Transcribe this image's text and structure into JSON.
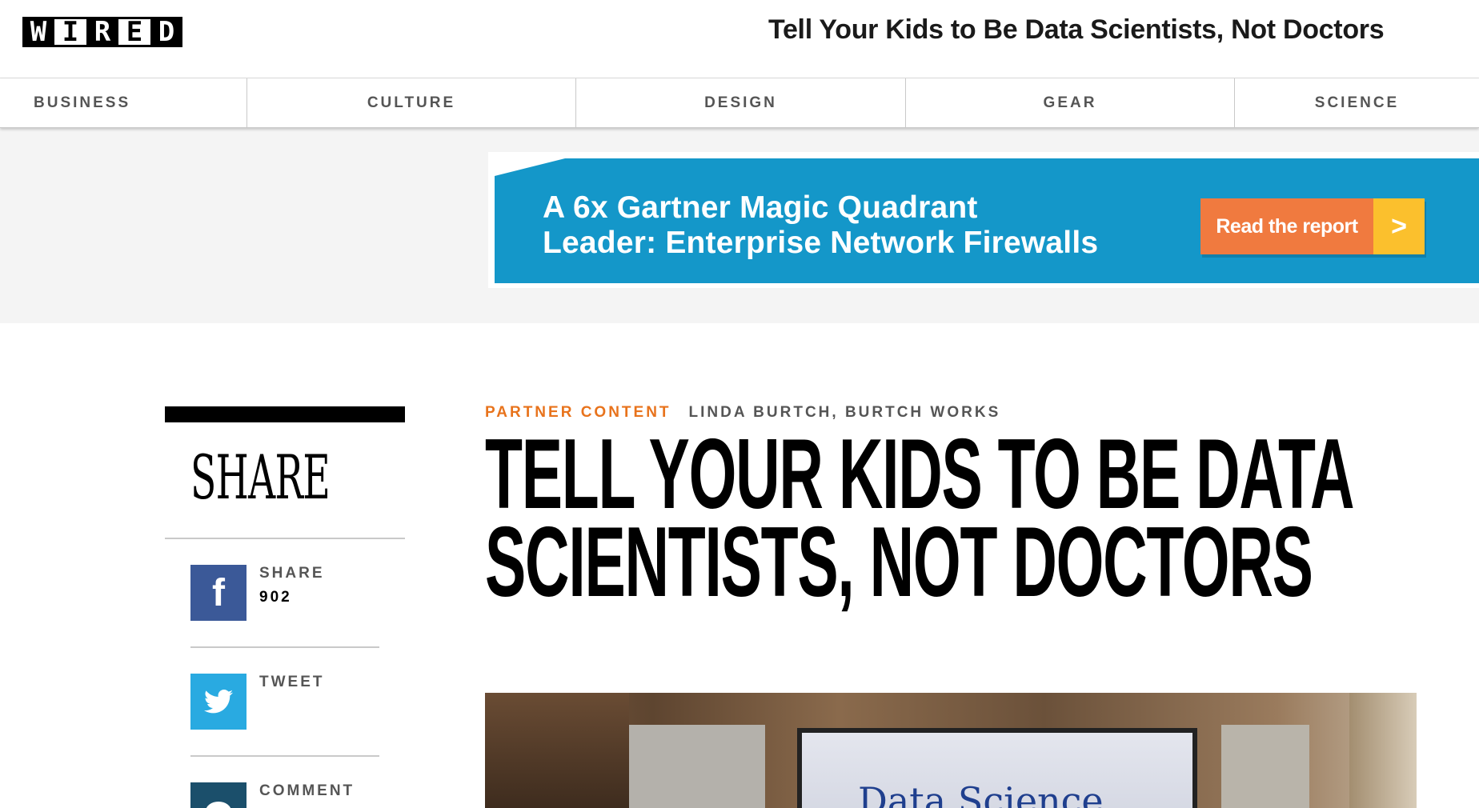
{
  "header": {
    "logo_letters": [
      "W",
      "I",
      "R",
      "E",
      "D"
    ],
    "title": "Tell Your Kids to Be Data Scientists, Not Doctors"
  },
  "nav": {
    "items": [
      "BUSINESS",
      "CULTURE",
      "DESIGN",
      "GEAR",
      "SCIENCE"
    ]
  },
  "ad": {
    "line1": "A 6x Gartner Magic Quadrant",
    "line2": "Leader: Enterprise Network Firewalls",
    "button_label": "Read the report",
    "button_arrow": ">",
    "colors": {
      "background": "#1497c9",
      "button": "#f07a3f",
      "arrow": "#fbc02d"
    }
  },
  "share": {
    "heading": "SHARE",
    "facebook": {
      "label": "SHARE",
      "count": "902",
      "icon": "facebook-icon"
    },
    "twitter": {
      "label": "TWEET",
      "icon": "twitter-icon"
    },
    "comment": {
      "label": "COMMENT",
      "icon": "comment-icon"
    }
  },
  "article": {
    "kicker": "PARTNER CONTENT",
    "byline": "LINDA BURTCH, BURTCH WORKS",
    "headline_line1": "TELL YOUR KIDS TO BE DATA",
    "headline_line2": "SCIENTISTS, NOT DOCTORS",
    "hero_text": "Data Science",
    "colors": {
      "kicker": "#e8731c"
    }
  }
}
